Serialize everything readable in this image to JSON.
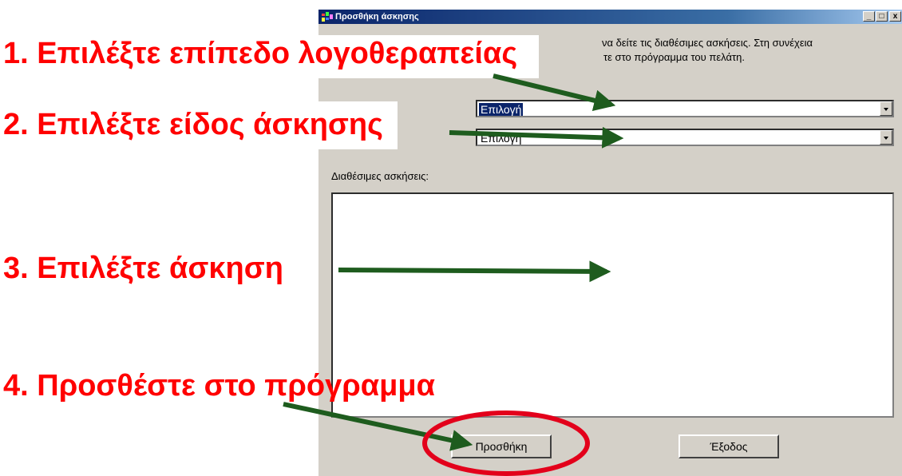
{
  "window": {
    "title": "Προσθήκη άσκησης",
    "controls": {
      "minimize": "_",
      "maximize": "□",
      "close": "x"
    }
  },
  "intro": {
    "line1": "να δείτε τις διαθέσιμες ασκήσεις. Στη συνέχεια",
    "line2": "τε στο πρόγραμμα του πελάτη."
  },
  "level_combo": {
    "value": "Επιλογή"
  },
  "type_combo": {
    "value": "Επιλογή"
  },
  "list": {
    "label": "Διαθέσιμες ασκήσεις:",
    "items": []
  },
  "buttons": {
    "add": "Προσθήκη",
    "exit": "Έξοδος"
  },
  "annotations": {
    "step1": "1. Επιλέξτε επίπεδο λογοθεραπείας",
    "step2": "2. Επιλέξτε είδος άσκησης",
    "step3": "3. Επιλέξτε άσκηση",
    "step4": "4. Προσθέστε στο πρόγραμμα"
  },
  "colors": {
    "annotation_text": "#ff0000",
    "arrow": "#1e5c1e",
    "highlight_circle": "#e3001b",
    "titlebar": "#0a246a",
    "dialog_face": "#d4d0c8"
  }
}
